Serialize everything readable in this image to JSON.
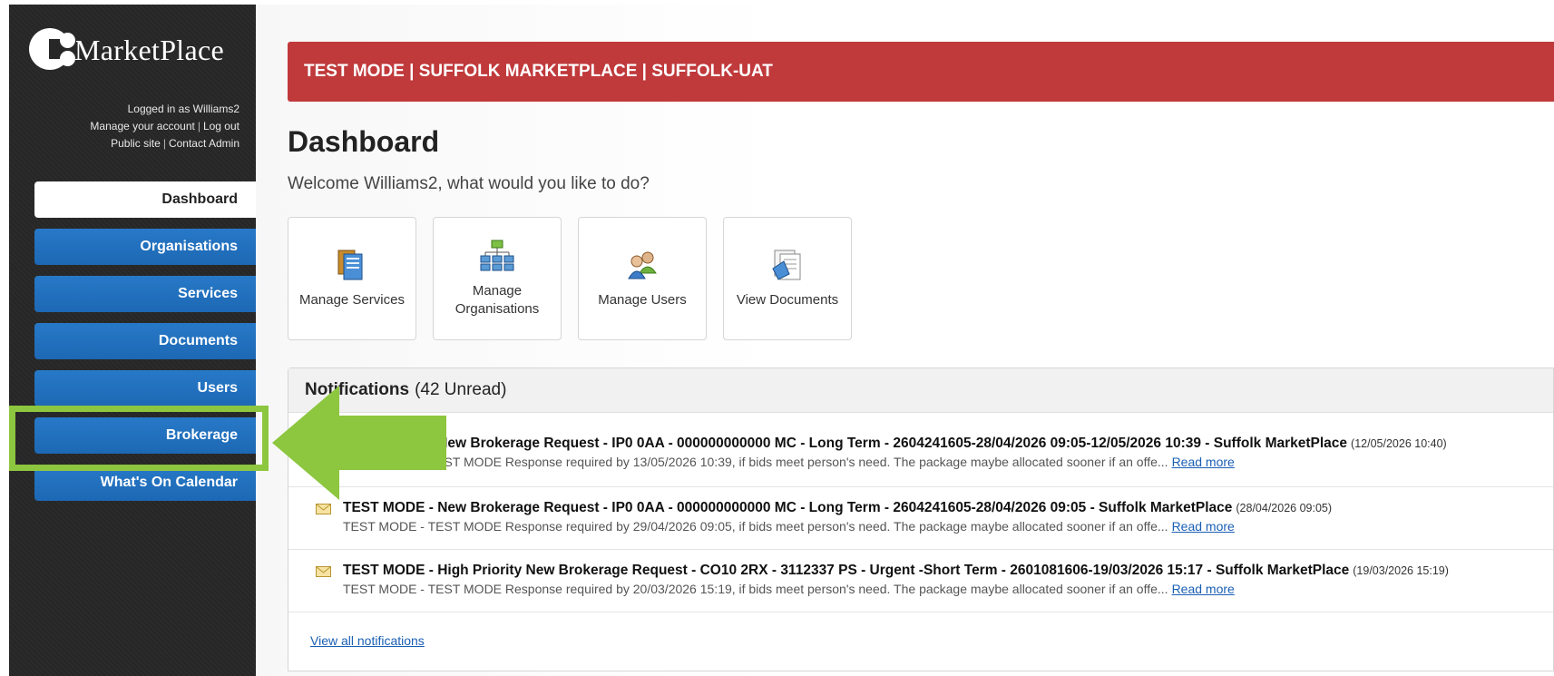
{
  "sidebar": {
    "logo_text": "MarketPlace",
    "logged_in": "Logged in as Williams2",
    "manage_account": "Manage your account",
    "log_out": "Log out",
    "public_site": "Public site",
    "contact_admin": "Contact Admin",
    "separator": "|",
    "items": [
      {
        "label": "Dashboard",
        "active": true
      },
      {
        "label": "Organisations"
      },
      {
        "label": "Services"
      },
      {
        "label": "Documents"
      },
      {
        "label": "Users"
      },
      {
        "label": "Brokerage"
      },
      {
        "label": "What's On Calendar"
      }
    ]
  },
  "banner": {
    "text": "TEST MODE | SUFFOLK MARKETPLACE | SUFFOLK-UAT"
  },
  "main": {
    "title": "Dashboard",
    "welcome": "Welcome Williams2, what would you like to do?",
    "tiles": [
      {
        "label": "Manage Services",
        "icon": "services-icon"
      },
      {
        "label": "Manage Organisations",
        "icon": "organisations-icon"
      },
      {
        "label": "Manage Users",
        "icon": "users-icon"
      },
      {
        "label": "View Documents",
        "icon": "documents-icon"
      }
    ]
  },
  "notifications": {
    "heading": "Notifications",
    "count": "(42 Unread)",
    "items": [
      {
        "title": "TEST MODE - New Brokerage Request - IP0 0AA - 000000000000 MC - Long Term - 2604241605-28/04/2026 09:05-12/05/2026 10:39 - Suffolk MarketPlace",
        "date": "(12/05/2026 10:40)",
        "body": "TEST MODE - TEST MODE Response required by 13/05/2026 10:39, if bids meet person's need. The package maybe allocated sooner if an offe...",
        "read_more": "Read more"
      },
      {
        "title": "TEST MODE - New Brokerage Request - IP0 0AA - 000000000000 MC - Long Term - 2604241605-28/04/2026 09:05 - Suffolk MarketPlace",
        "date": "(28/04/2026 09:05)",
        "body": "TEST MODE - TEST MODE Response required by 29/04/2026 09:05, if bids meet person's need. The package maybe allocated sooner if an offe...",
        "read_more": "Read more"
      },
      {
        "title": "TEST MODE - High Priority New Brokerage Request - CO10 2RX - 3112337 PS - Urgent -Short Term - 2601081606-19/03/2026 15:17 - Suffolk MarketPlace",
        "date": "(19/03/2026 15:19)",
        "body": "TEST MODE - TEST MODE Response required by 20/03/2026 15:19, if bids meet person's need. The package maybe allocated sooner if an offe...",
        "read_more": "Read more"
      }
    ],
    "view_all": "View all notifications"
  },
  "colors": {
    "banner": "#c0393b",
    "nav": "#1f6fbf",
    "highlight": "#8dc63f",
    "link": "#1a5fb4"
  }
}
